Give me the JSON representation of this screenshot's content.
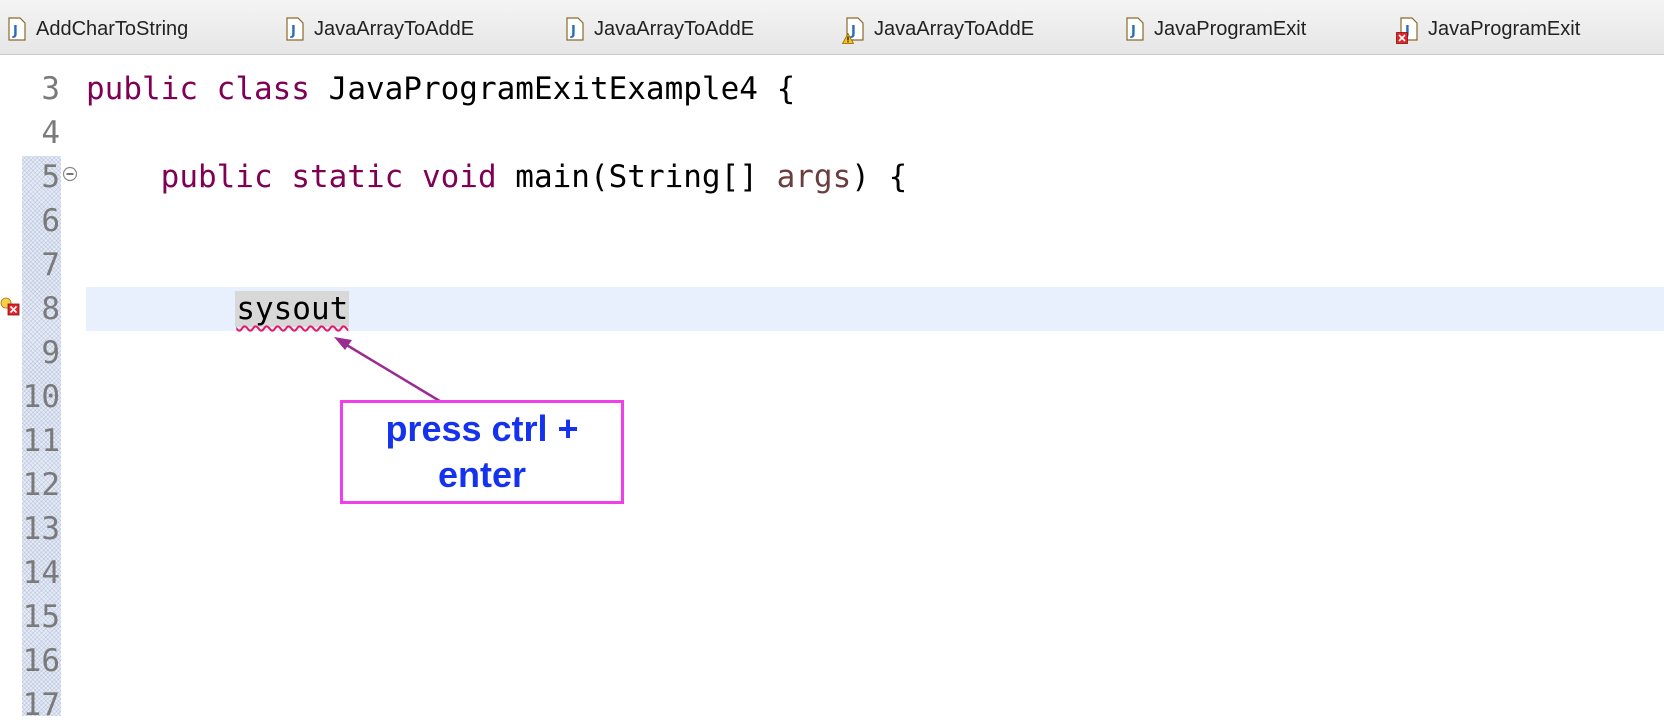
{
  "tabs": [
    {
      "label": "AddCharToString",
      "icon": "java-file-icon",
      "overlay": ""
    },
    {
      "label": "JavaArrayToAddE",
      "icon": "java-file-icon",
      "overlay": ""
    },
    {
      "label": "JavaArrayToAddE",
      "icon": "java-file-icon",
      "overlay": ""
    },
    {
      "label": "JavaArrayToAddE",
      "icon": "java-file-icon",
      "overlay": "warning"
    },
    {
      "label": "JavaProgramExit",
      "icon": "java-file-icon",
      "overlay": ""
    },
    {
      "label": "JavaProgramExit",
      "icon": "java-file-icon",
      "overlay": "error"
    }
  ],
  "editor": {
    "line_numbers": [
      "3",
      "4",
      "5",
      "6",
      "7",
      "8",
      "9",
      "10",
      "11",
      "12",
      "13",
      "14",
      "15",
      "16",
      "17"
    ],
    "code": {
      "line3": {
        "kw1": "public",
        "kw2": "class",
        "rest": "JavaProgramExitExample4 {"
      },
      "line5": {
        "kw1": "public",
        "kw2": "static",
        "kw3": "void",
        "method": "main(String[] ",
        "param": "args",
        "rest": ") {"
      },
      "line8": {
        "text": "sysout"
      }
    },
    "current_line": "8",
    "colors": {
      "keyword": "#7f0055",
      "parameter": "#6a3e3e",
      "error_underline": "#e01b6a",
      "current_line_bg": "#e8f0fd"
    }
  },
  "annotation": {
    "line1": "press ctrl +",
    "line2": "enter",
    "text_color": "#1533ef",
    "border_color": "#ee3fe8",
    "arrow_color": "#9b2a91"
  }
}
